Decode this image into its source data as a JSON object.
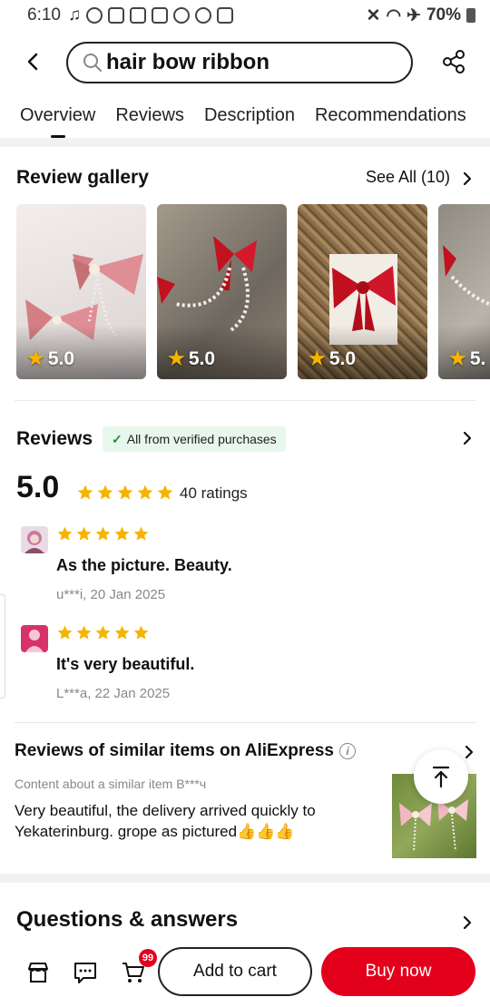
{
  "statusbar": {
    "time": "6:10",
    "battery": "70%"
  },
  "search": {
    "query": "hair bow ribbon"
  },
  "tabs": [
    {
      "label": "Overview"
    },
    {
      "label": "Reviews"
    },
    {
      "label": "Description"
    },
    {
      "label": "Recommendations"
    }
  ],
  "gallery": {
    "title": "Review gallery",
    "see_all": "See All (10)",
    "items": [
      {
        "rating": "5.0"
      },
      {
        "rating": "5.0"
      },
      {
        "rating": "5.0"
      },
      {
        "rating": "5."
      }
    ]
  },
  "reviews": {
    "title": "Reviews",
    "verified_badge": "All from verified purchases",
    "score": "5.0",
    "ratings_count": "40 ratings",
    "stars": 5,
    "items": [
      {
        "text": "As the picture. Beauty.",
        "meta": "u***i, 20 Jan 2025",
        "stars": 5
      },
      {
        "text": "It's very beautiful.",
        "meta": "L***a, 22 Jan 2025",
        "stars": 5
      }
    ]
  },
  "similar": {
    "title": "Reviews of similar items on AliExpress",
    "subtitle": "Content about a similar item B***ч",
    "text": "Very beautiful, the delivery arrived quickly to Yekaterinburg. grope as pictured👍👍👍"
  },
  "qa": {
    "title": "Questions & answers"
  },
  "bottombar": {
    "cart_badge": "99",
    "add_to_cart": "Add to cart",
    "buy_now": "Buy now"
  },
  "colors": {
    "accent": "#e3001b",
    "star": "#f5b400",
    "verified_bg": "#e8f7ec"
  }
}
